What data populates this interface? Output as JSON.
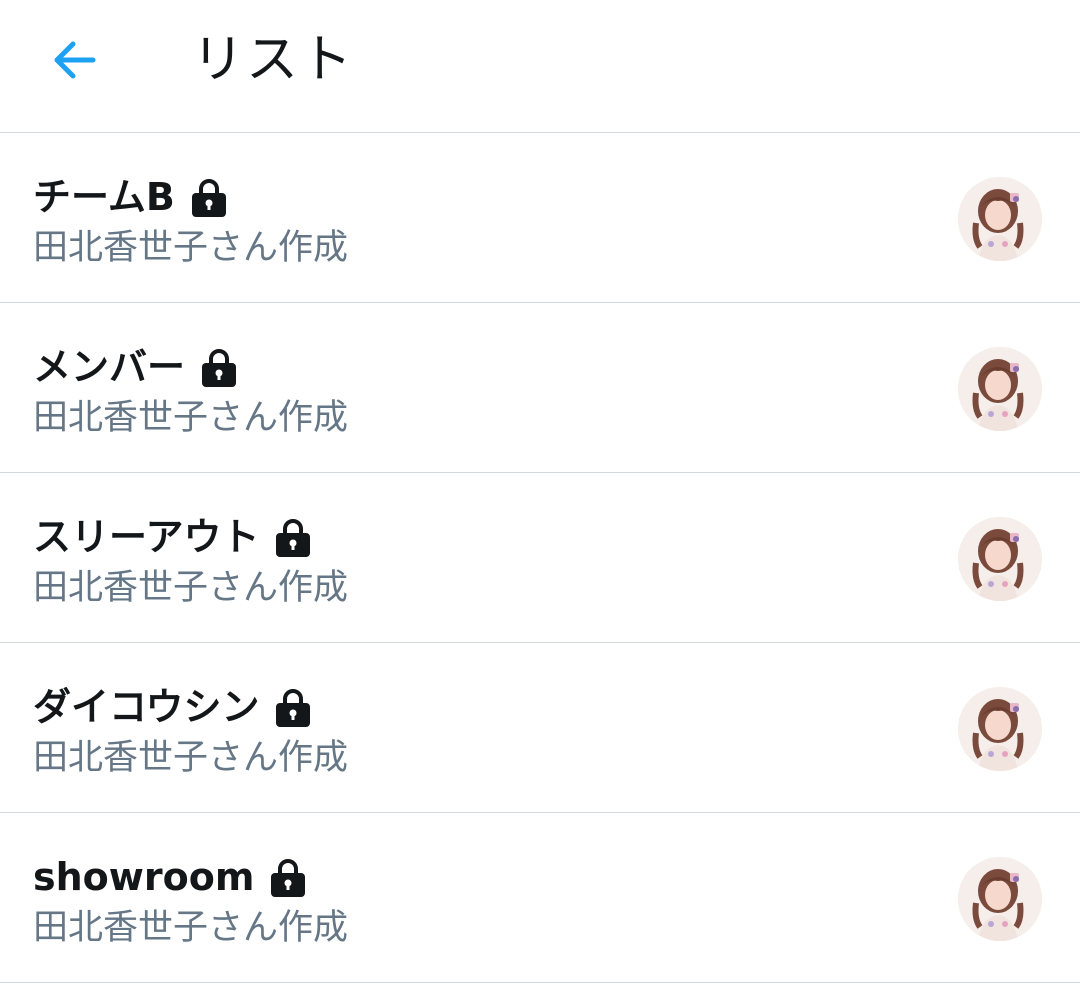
{
  "header": {
    "title": "リスト",
    "back_icon": "arrow-left-icon",
    "accent_color": "#1da1f2"
  },
  "lists": [
    {
      "name": "チームB",
      "creator": "田北香世子さん作成",
      "private_icon": "lock-icon"
    },
    {
      "name": "メンバー",
      "creator": "田北香世子さん作成",
      "private_icon": "lock-icon"
    },
    {
      "name": "スリーアウト",
      "creator": "田北香世子さん作成",
      "private_icon": "lock-icon"
    },
    {
      "name": "ダイコウシン",
      "creator": "田北香世子さん作成",
      "private_icon": "lock-icon"
    },
    {
      "name": "showroom",
      "creator": "田北香世子さん作成",
      "private_icon": "lock-icon"
    }
  ],
  "colors": {
    "primary_text": "#14171a",
    "secondary_text": "#657786",
    "divider": "#d3d8dc"
  }
}
